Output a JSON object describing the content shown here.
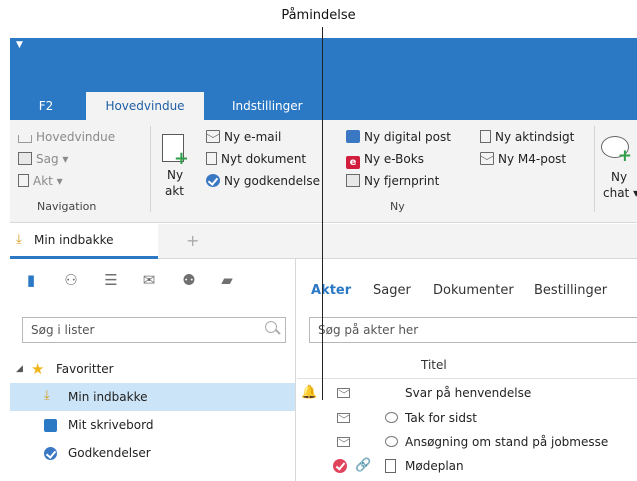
{
  "callout": {
    "label": "Påmindelse"
  },
  "ribbon_tabs": [
    {
      "label": "F2"
    },
    {
      "label": "Hovedvindue"
    },
    {
      "label": "Indstillinger"
    }
  ],
  "ribbon": {
    "navigation": {
      "items": [
        "Hovedvindue",
        "Sag ▾",
        "Akt ▾"
      ],
      "group_label": "Navigation"
    },
    "ny_akt": {
      "line1": "Ny",
      "line2": "akt"
    },
    "ny": {
      "col1": [
        "Ny e-mail",
        "Nyt dokument",
        "Ny godkendelse"
      ],
      "col2": [
        "Ny digital post",
        "Ny e-Boks",
        "Ny fjernprint"
      ],
      "col3": [
        "Ny aktindsigt",
        "Ny M4-post"
      ],
      "group_label": "Ny"
    },
    "ny_chat": {
      "line1": "Ny",
      "line2": "chat ▾"
    }
  },
  "doc_tab": {
    "label": "Min indbakke"
  },
  "left": {
    "search_placeholder": "Søg i lister",
    "tree": {
      "favorites": "Favoritter",
      "items": [
        "Min indbakke",
        "Mit skrivebord",
        "Godkendelser"
      ]
    }
  },
  "right": {
    "tabs": [
      "Akter",
      "Sager",
      "Dokumenter",
      "Bestillinger"
    ],
    "search_placeholder": "Søg på akter her",
    "column_title": "Titel",
    "rows": [
      {
        "title": "Svar på henvendelse"
      },
      {
        "title": "Tak for sidst"
      },
      {
        "title": "Ansøgning om stand på jobmesse"
      },
      {
        "title": "Mødeplan"
      }
    ]
  },
  "colors": {
    "accent": "#2b78c5",
    "selected": "#cce4f7",
    "bell": "#e8a630",
    "eboks": "#d21e3c",
    "green": "#2e9e4a"
  }
}
